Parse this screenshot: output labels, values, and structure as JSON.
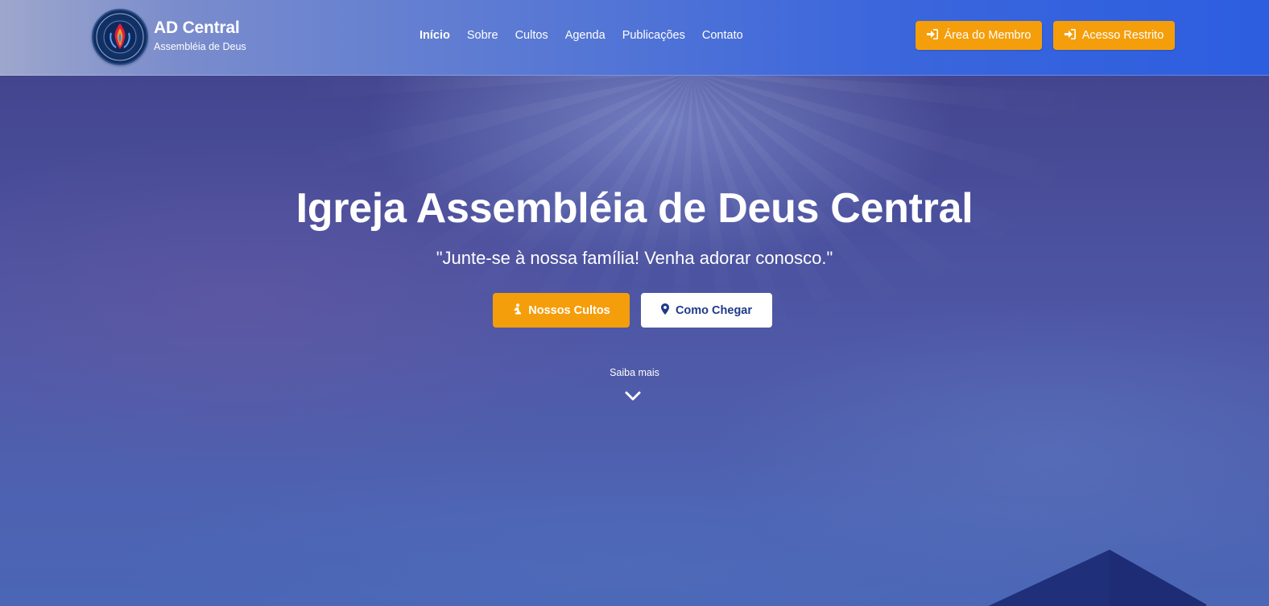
{
  "brand": {
    "title": "AD Central",
    "subtitle": "Assembléia de Deus",
    "logo_icon": "church-flame-seal-icon"
  },
  "nav": {
    "items": [
      {
        "label": "Início",
        "active": true
      },
      {
        "label": "Sobre",
        "active": false
      },
      {
        "label": "Cultos",
        "active": false
      },
      {
        "label": "Agenda",
        "active": false
      },
      {
        "label": "Publicações",
        "active": false
      },
      {
        "label": "Contato",
        "active": false
      }
    ]
  },
  "header_buttons": {
    "member_label": "Área do Membro",
    "restricted_label": "Acesso Restrito",
    "icon": "sign-in-icon"
  },
  "hero": {
    "title": "Igreja Assembléia de Deus Central",
    "subtitle": "\"Junte-se à nossa família! Venha adorar conosco.\"",
    "cta_primary": "Nossos Cultos",
    "cta_primary_icon": "praying-person-icon",
    "cta_secondary": "Como Chegar",
    "cta_secondary_icon": "map-pin-icon",
    "scroll_hint": "Saiba mais",
    "scroll_icon": "chevron-down-icon"
  },
  "colors": {
    "accent": "#f59e0b",
    "header_blue": "#2d5ee0",
    "hero_overlay": "#4a54a3",
    "secondary_text": "#1e3a8a"
  }
}
